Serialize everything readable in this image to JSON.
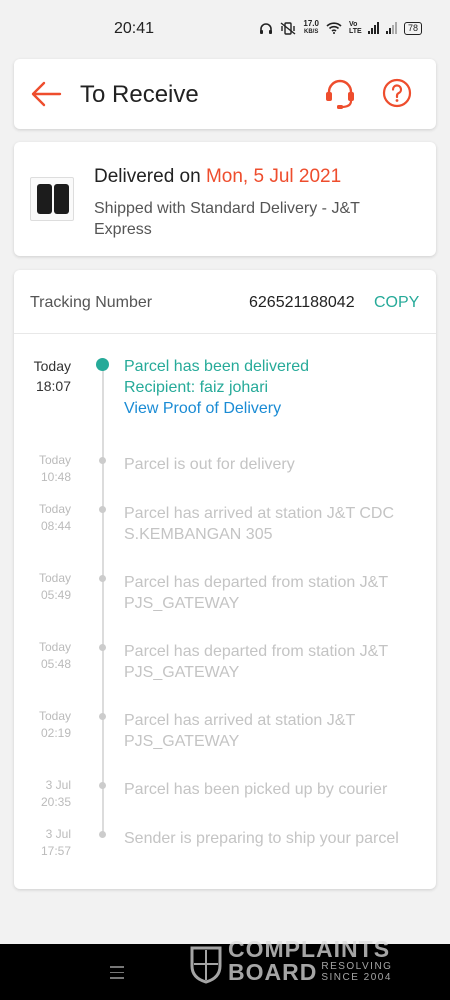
{
  "status_bar": {
    "time": "20:41",
    "net_speed_value": "17.0",
    "net_speed_unit": "KB/S",
    "volte_label": "Vo LTE",
    "battery": "78"
  },
  "header": {
    "title": "To Receive",
    "accent_color": "#ee4d2d"
  },
  "delivery": {
    "delivered_prefix": "Delivered on",
    "delivered_date": "Mon, 5 Jul 2021",
    "shipped_text": "Shipped with Standard Delivery  - J&T Express"
  },
  "tracking": {
    "label": "Tracking Number",
    "number": "626521188042",
    "copy_label": "COPY",
    "copy_color": "#26aa99"
  },
  "timeline": {
    "latest": {
      "day": "Today",
      "time": "18:07",
      "status": "Parcel has been delivered",
      "recipient": "Recipient: faiz johari",
      "proof_link": "View Proof of Delivery"
    },
    "events": [
      {
        "day": "Today",
        "time": "10:48",
        "text": "Parcel is out for delivery"
      },
      {
        "day": "Today",
        "time": "08:44",
        "text": "Parcel has arrived at station J&T CDC S.KEMBANGAN 305"
      },
      {
        "day": "Today",
        "time": "05:49",
        "text": "Parcel has departed from station J&T PJS_GATEWAY"
      },
      {
        "day": "Today",
        "time": "05:48",
        "text": "Parcel has departed from station J&T PJS_GATEWAY"
      },
      {
        "day": "Today",
        "time": "02:19",
        "text": "Parcel has arrived at station J&T PJS_GATEWAY"
      },
      {
        "day": "3 Jul",
        "time": "20:35",
        "text": "Parcel has been picked up by courier"
      },
      {
        "day": "3 Jul",
        "time": "17:57",
        "text": "Sender is preparing to ship your parcel"
      }
    ]
  },
  "watermark": {
    "line1": "COMPLAINTS",
    "line2": "BOARD",
    "tagline": "RESOLVING SINCE 2004"
  }
}
